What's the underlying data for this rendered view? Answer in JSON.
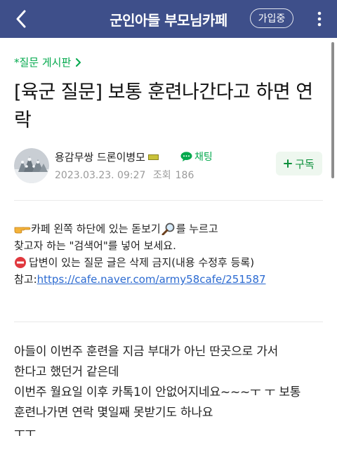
{
  "header": {
    "title": "군인아들 부모님카페",
    "join_label": "가입중"
  },
  "post": {
    "board_link": "*질문 게시판",
    "title": "[육군 질문] 보통 훈련나간다고 하면 연락",
    "author": {
      "name": "용감무쌍 드론이병모",
      "chat_label": "채팅",
      "date": "2023.03.23. 09:27",
      "views_label": "조회",
      "views": "186"
    },
    "subscribe_label": "구독"
  },
  "notice": {
    "line1_a": "카페 왼쪽 하단에 있는 돋보기",
    "line1_b": "를 누르고",
    "line2": "찾고자 하는 \"검색어\"를 넣어 보세요.",
    "line3": "답변이 있는 질문 글은 삭제 금지(내용 수정후 등록)",
    "ref_label": "참고:",
    "ref_link": "https://cafe.naver.com/army58cafe/251587"
  },
  "body": {
    "lines": [
      "아들이 이번주 훈련을  지금 부대가 아닌  딴곳으로 가서",
      "한다고 했던거 같은데",
      "이번주 월요일 이후 카톡1이 안없어지네요~~~ㅜ ㅜ 보통",
      "훈련나가면 연락 몇일째 못받기도 하나요",
      "ㅜㅜ"
    ]
  },
  "colors": {
    "header_bg": "#3e4f8a",
    "accent_green": "#03a94d",
    "link_blue": "#2b6ad1"
  },
  "icons": [
    "back-arrow-icon",
    "more-vertical-icon",
    "chevron-right-icon",
    "chat-bubble-icon",
    "plus-icon",
    "pointing-hand-icon",
    "magnifier-icon",
    "no-entry-icon"
  ]
}
